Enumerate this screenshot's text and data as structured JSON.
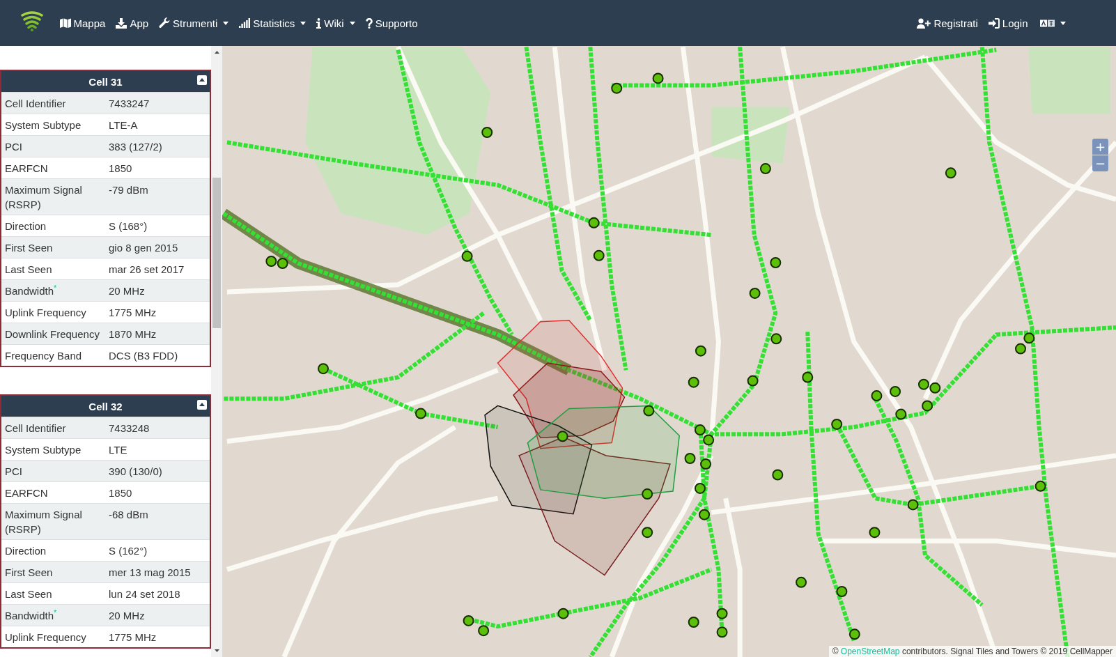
{
  "navbar": {
    "menu": [
      {
        "label": "Mappa",
        "dropdown": false
      },
      {
        "label": "App",
        "dropdown": false
      },
      {
        "label": "Strumenti",
        "dropdown": true
      },
      {
        "label": "Statistics",
        "dropdown": true
      },
      {
        "label": "Wiki",
        "dropdown": true
      },
      {
        "label": "Supporto",
        "dropdown": false
      }
    ],
    "account": [
      {
        "label": "Registrati"
      },
      {
        "label": "Login"
      }
    ],
    "language": {
      "dropdown": true
    }
  },
  "sidebar": {
    "cells": [
      {
        "title": "Cell 31",
        "expanded": true,
        "rows": [
          {
            "label": "Cell Identifier",
            "value": "7433247"
          },
          {
            "label": "System Subtype",
            "value": "LTE-A"
          },
          {
            "label": "PCI",
            "value": "383 (127/2)"
          },
          {
            "label": "EARFCN",
            "value": "1850"
          },
          {
            "label": "Maximum Signal (RSRP)",
            "value": "-79 dBm"
          },
          {
            "label": "Direction",
            "value": "S (168°)"
          },
          {
            "label": "First Seen",
            "value": "gio 8 gen 2015"
          },
          {
            "label": "Last Seen",
            "value": "mar 26 set 2017"
          },
          {
            "label": "Bandwidth$^{*}$",
            "value": "20 MHz"
          },
          {
            "label": "Uplink Frequency",
            "value": "1775 MHz"
          },
          {
            "label": "Downlink Frequency",
            "value": "1870 MHz"
          },
          {
            "label": "Frequency Band",
            "value": "DCS (B3 FDD)"
          }
        ]
      },
      {
        "title": "Cell 32",
        "expanded": true,
        "rows": [
          {
            "label": "Cell Identifier",
            "value": "7433248"
          },
          {
            "label": "System Subtype",
            "value": "LTE"
          },
          {
            "label": "PCI",
            "value": "390 (130/0)"
          },
          {
            "label": "EARFCN",
            "value": "1850"
          },
          {
            "label": "Maximum Signal (RSRP)",
            "value": "-68 dBm"
          },
          {
            "label": "Direction",
            "value": "S (162°)"
          },
          {
            "label": "First Seen",
            "value": "mer 13 mag 2015"
          },
          {
            "label": "Last Seen",
            "value": "lun 24 set 2018"
          },
          {
            "label": "Bandwidth$^{*}$",
            "value": "20 MHz"
          },
          {
            "label": "Uplink Frequency",
            "value": "1775 MHz"
          }
        ]
      }
    ]
  },
  "map": {
    "zoom_controls": [
      {
        "label": "+"
      },
      {
        "label": "−"
      }
    ],
    "attribution": {
      "prefix": "©",
      "link": "OpenStreetMap",
      "suffix": "contributors. Signal Tiles and Towers © 2019 CellMapper"
    }
  }
}
